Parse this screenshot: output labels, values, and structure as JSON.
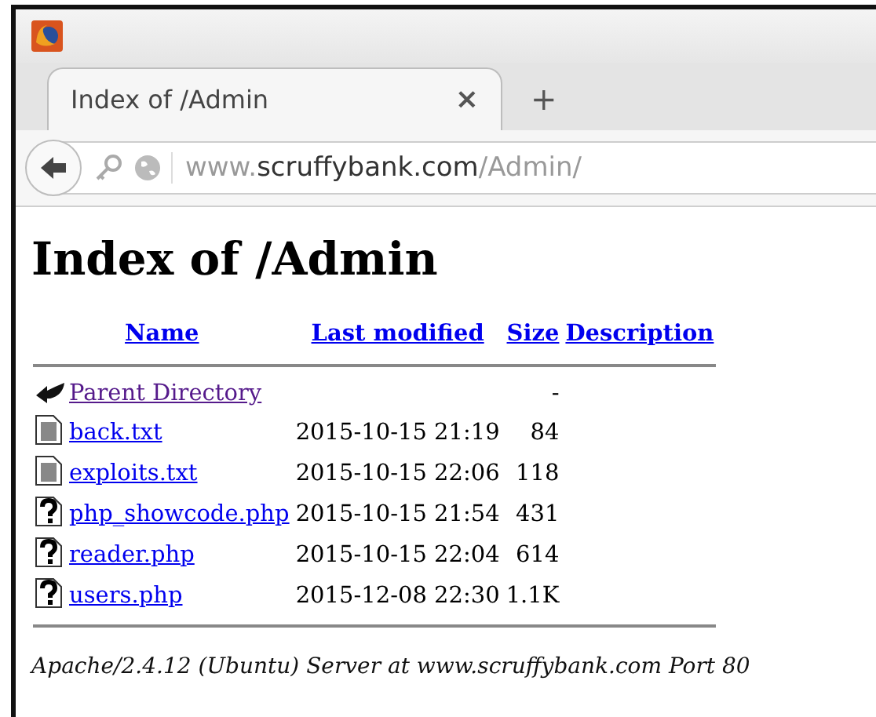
{
  "browser": {
    "tabs": [
      {
        "title": "Index of /Admin",
        "close": "×",
        "selected": true
      }
    ],
    "new_tab": "+",
    "url": {
      "prefix": "www.",
      "domain": "scruffybank.com",
      "path": "/Admin/"
    }
  },
  "page": {
    "heading": "Index of /Admin",
    "table": {
      "columns": [
        "Name",
        "Last modified",
        "Size",
        "Description"
      ],
      "rows": [
        {
          "kind": "back",
          "name": "Parent Directory",
          "visited": true,
          "modified": "",
          "size": "-"
        },
        {
          "kind": "text",
          "name": "back.txt",
          "visited": false,
          "modified": "2015-10-15 21:19",
          "size": "84"
        },
        {
          "kind": "text",
          "name": "exploits.txt",
          "visited": false,
          "modified": "2015-10-15 22:06",
          "size": "118"
        },
        {
          "kind": "unknown",
          "name": "php_showcode.php",
          "visited": false,
          "modified": "2015-10-15 21:54",
          "size": "431"
        },
        {
          "kind": "unknown",
          "name": "reader.php",
          "visited": false,
          "modified": "2015-10-15 22:04",
          "size": "614"
        },
        {
          "kind": "unknown",
          "name": "users.php",
          "visited": false,
          "modified": "2015-12-08 22:30",
          "size": "1.1K"
        }
      ]
    },
    "footer": "Apache/2.4.12 (Ubuntu) Server at www.scruffybank.com Port 80"
  }
}
